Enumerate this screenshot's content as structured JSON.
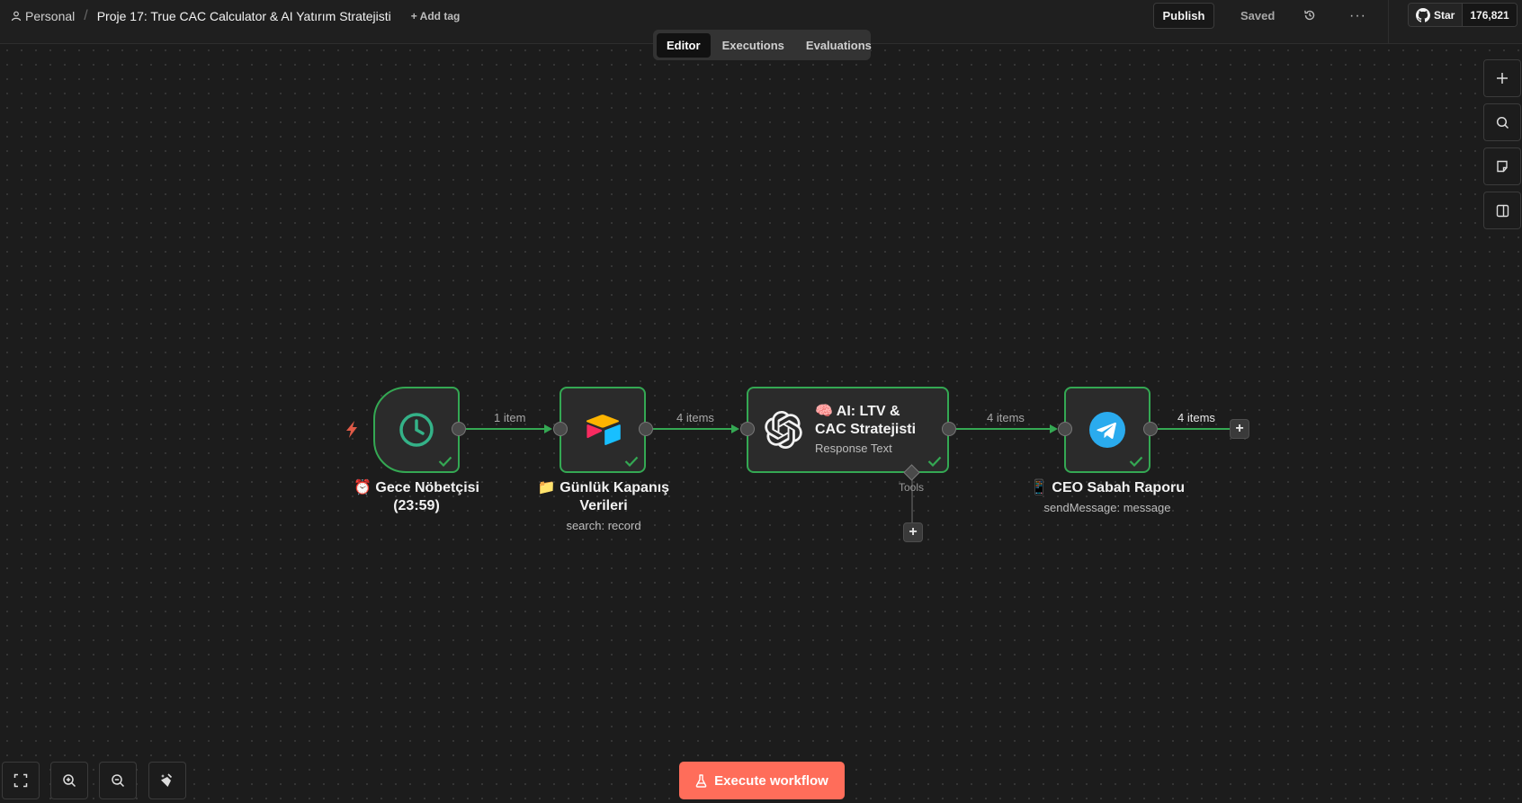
{
  "header": {
    "personal": "Personal",
    "workflow_title": "Proje 17: True CAC Calculator & AI Yatırım Stratejisti",
    "add_tag": "+ Add tag",
    "publish": "Publish",
    "saved": "Saved",
    "github_star": "Star",
    "github_count": "176,821"
  },
  "tabs": [
    {
      "label": "Editor",
      "active": true
    },
    {
      "label": "Executions",
      "active": false
    },
    {
      "label": "Evaluations",
      "active": false
    }
  ],
  "nodes": {
    "trigger": {
      "title_line1": "⏰ Gece Nöbetçisi",
      "title_line2": "(23:59)",
      "icon": "clock-icon"
    },
    "airtable": {
      "title_line1": "📁 Günlük Kapanış",
      "title_line2": "Verileri",
      "subtitle": "search: record",
      "icon": "airtable-icon"
    },
    "ai": {
      "title_line1": "🧠 AI: LTV &",
      "title_line2": "CAC Stratejisti",
      "subtitle": "Response Text",
      "icon": "openai-icon",
      "tools_label": "Tools"
    },
    "telegram": {
      "title": "📱 CEO Sabah Raporu",
      "subtitle": "sendMessage: message",
      "icon": "telegram-icon"
    }
  },
  "edges": [
    {
      "label": "1 item"
    },
    {
      "label": "4 items"
    },
    {
      "label": "4 items"
    },
    {
      "label": "4 items"
    }
  ],
  "footer": {
    "execute_label": "Execute workflow"
  },
  "colors": {
    "success": "#34a853",
    "accent": "#ff6d5a",
    "trigger_bolt": "#ff6d5a"
  }
}
